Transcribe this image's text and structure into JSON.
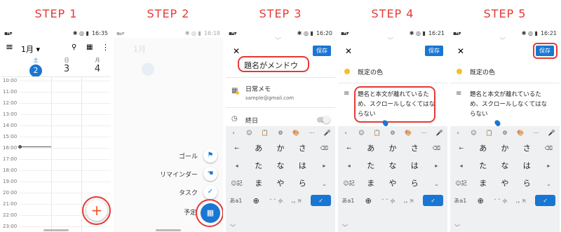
{
  "steps": [
    "STEP 1",
    "STEP 2",
    "STEP 3",
    "STEP 4",
    "STEP 5"
  ],
  "p1": {
    "time": "16:35",
    "month": "1月",
    "days": [
      {
        "dow": "土",
        "num": "2"
      },
      {
        "dow": "日",
        "num": "3"
      },
      {
        "dow": "月",
        "num": "4"
      }
    ],
    "hours": [
      "10:00",
      "11:00",
      "12:00",
      "13:00",
      "14:00",
      "15:00",
      "16:00",
      "17:00",
      "18:00",
      "19:00",
      "20:00",
      "21:00",
      "22:00",
      "23:00"
    ],
    "fab": "+"
  },
  "p2": {
    "time": "16:18",
    "month": "1月",
    "items": [
      "ゴール",
      "リマインダー",
      "タスク",
      "予定"
    ]
  },
  "p3": {
    "time": "16:20",
    "save": "保存",
    "title": "題名がメンドウ",
    "cal": "日常メモ",
    "email": "sample@gmail.com",
    "allday": "終日"
  },
  "p4": {
    "time": "16:21",
    "save": "保存",
    "color": "既定の色",
    "body": "題名と本文が離れているため、スクロールしなくてはならない"
  },
  "p5": {
    "time": "16:21",
    "save": "保存",
    "color": "既定の色",
    "body": "題名と本文が離れているため、スクロールしなくてはならない"
  },
  "kb": {
    "rows": [
      [
        "←",
        "あ",
        "か",
        "さ",
        "⌫"
      ],
      [
        "◂",
        "た",
        "な",
        "は",
        "▸"
      ],
      [
        "☺記",
        "ま",
        "や",
        "ら",
        "⎵"
      ],
      [
        "あa1",
        "⊕",
        "゛゜小",
        "、。?!",
        "✓"
      ]
    ],
    "toolbar": [
      "‹",
      "☺",
      "📋",
      "⚙",
      "🎨",
      "⋯",
      "🎤"
    ]
  },
  "colors": {
    "accent": "#1976d2",
    "red": "#e53935",
    "yellow": "#f6bf26"
  }
}
